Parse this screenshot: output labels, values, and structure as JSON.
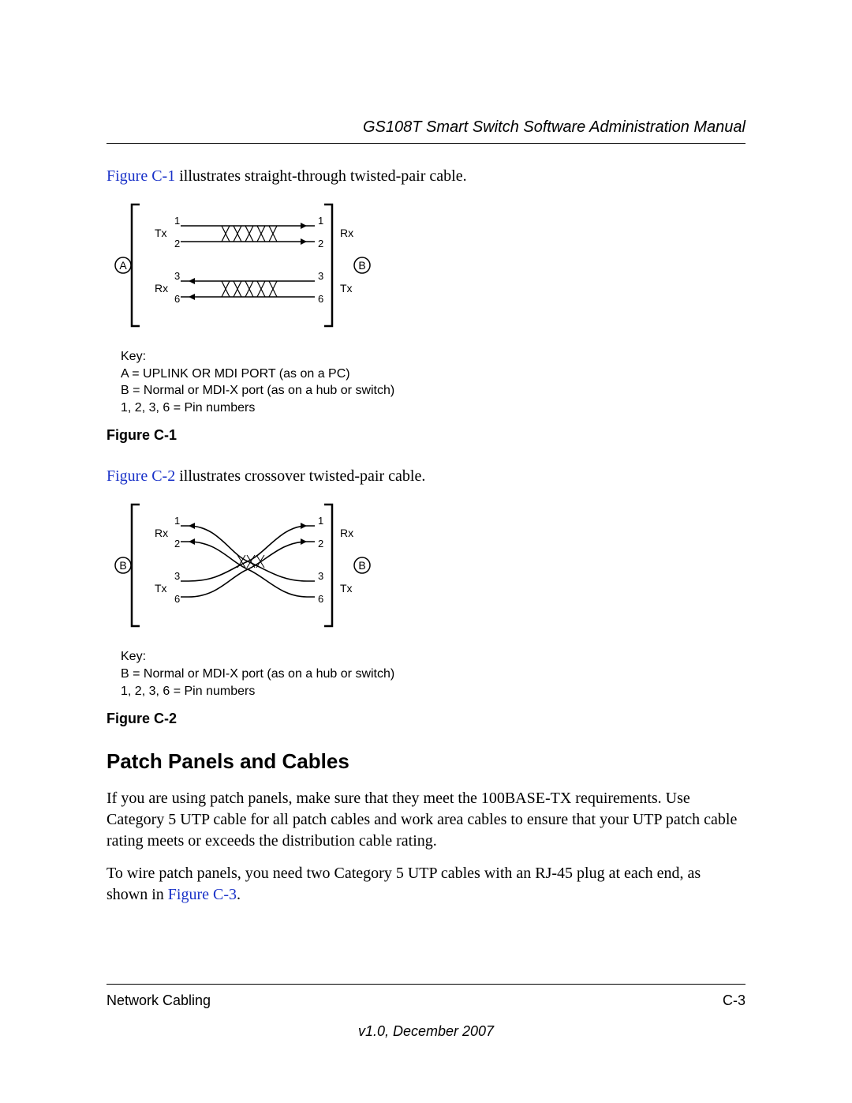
{
  "header": {
    "title": "GS108T Smart Switch Software Administration Manual"
  },
  "intro1": {
    "link_text": "Figure C-1",
    "rest": " illustrates straight-through twisted-pair cable."
  },
  "figure1": {
    "caption": "Figure C-1",
    "left_circle": "A",
    "right_circle": "B",
    "left_top_label": "Tx",
    "left_bottom_label": "Rx",
    "right_top_label": "Rx",
    "right_bottom_label": "Tx",
    "pin1": "1",
    "pin2": "2",
    "pin3": "3",
    "pin6": "6",
    "key_heading": "Key:",
    "key_a": "A = UPLINK OR MDI PORT (as on a PC)",
    "key_b": "B = Normal or MDI-X port (as on a hub or switch)",
    "key_pins": "1, 2, 3, 6 = Pin numbers"
  },
  "intro2": {
    "link_text": "Figure C-2",
    "rest": " illustrates crossover twisted-pair cable."
  },
  "figure2": {
    "caption": "Figure C-2",
    "left_circle": "B",
    "right_circle": "B",
    "left_top_label": "Rx",
    "left_bottom_label": "Tx",
    "right_top_label": "Rx",
    "right_bottom_label": "Tx",
    "pin1": "1",
    "pin2": "2",
    "pin3": "3",
    "pin6": "6",
    "key_heading": "Key:",
    "key_b": "B = Normal or MDI-X port (as on a hub or switch)",
    "key_pins": "1, 2, 3, 6 = Pin numbers"
  },
  "section": {
    "heading": "Patch Panels and Cables",
    "para1": "If you are using patch panels, make sure that they meet the 100BASE-TX requirements. Use Category 5 UTP cable for all patch cables and work area cables to ensure that your UTP patch cable rating meets or exceeds the distribution cable rating.",
    "para2_pre": "To wire patch panels, you need two Category 5 UTP cables with an RJ-45 plug at each end, as shown in ",
    "para2_link": "Figure C-3",
    "para2_post": "."
  },
  "footer": {
    "left": "Network Cabling",
    "right": "C-3",
    "version": "v1.0, December 2007"
  }
}
